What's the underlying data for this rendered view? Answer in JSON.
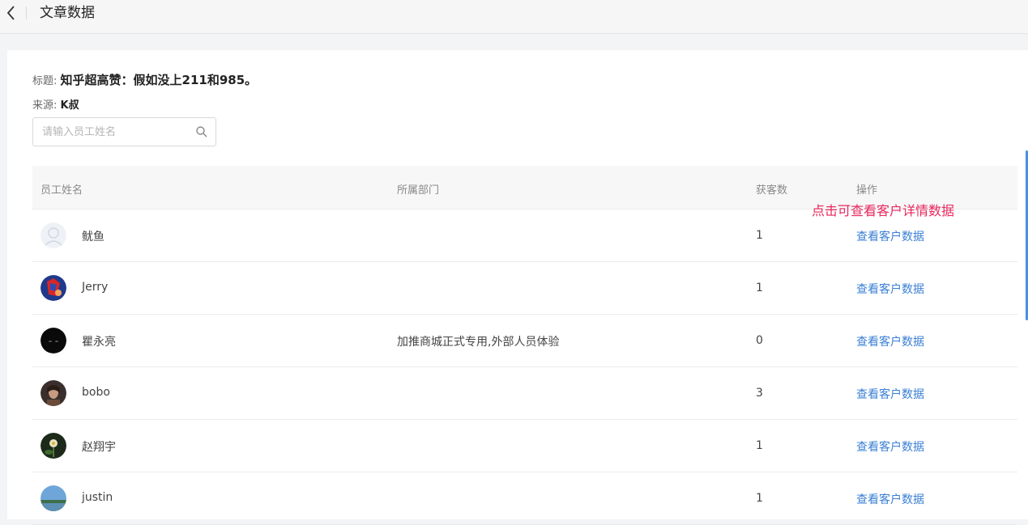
{
  "header": {
    "title": "文章数据",
    "back_icon": "chevron-left-icon"
  },
  "article": {
    "title_label": "标题:",
    "title_value": "知乎超高赞：假如没上211和985。",
    "source_label": "来源:",
    "source_value": "K叔"
  },
  "search": {
    "placeholder": "请输入员工姓名",
    "value": "",
    "icon": "search-icon"
  },
  "table": {
    "columns": [
      "员工姓名",
      "所属部门",
      "获客数",
      "操作"
    ],
    "annotation": "点击可查看客户详情数据",
    "rows": [
      {
        "name": "鱿鱼",
        "department": "",
        "count": "1",
        "action": "查看客户数据",
        "avatar": "default-avatar"
      },
      {
        "name": "Jerry",
        "department": "",
        "count": "1",
        "action": "查看客户数据",
        "avatar": "spiderman-avatar"
      },
      {
        "name": "瞿永亮",
        "department": "加推商城正式专用,外部人员体验",
        "count": "0",
        "action": "查看客户数据",
        "avatar": "dark-avatar"
      },
      {
        "name": "bobo",
        "department": "",
        "count": "3",
        "action": "查看客户数据",
        "avatar": "photo-avatar"
      },
      {
        "name": "赵翔宇",
        "department": "",
        "count": "1",
        "action": "查看客户数据",
        "avatar": "flower-avatar"
      },
      {
        "name": "justin",
        "department": "",
        "count": "1",
        "action": "查看客户数据",
        "avatar": "landscape-avatar"
      }
    ]
  },
  "colors": {
    "link": "#3a7fd5",
    "annotation": "#e8275d",
    "scroll_indicator": "#4a90e2"
  }
}
